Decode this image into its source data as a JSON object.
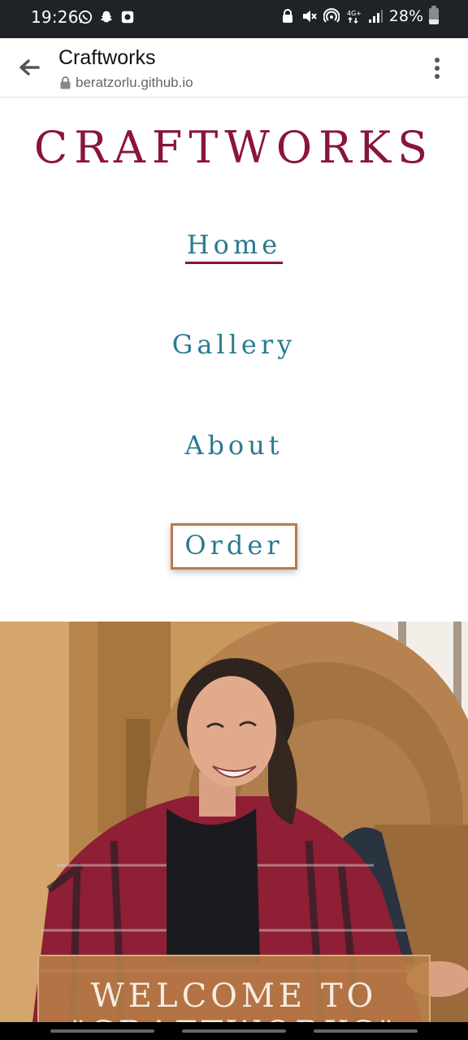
{
  "status_bar": {
    "time": "19:26",
    "battery_percent": "28%",
    "left_icons": [
      "whatsapp-icon",
      "snapchat-icon",
      "notification-icon"
    ],
    "right_icons": [
      "lock-icon",
      "mute-icon",
      "hotspot-icon",
      "4g-icon",
      "signal-icon"
    ]
  },
  "browser": {
    "title": "Craftworks",
    "url": "beratzorlu.github.io"
  },
  "page": {
    "brand": "CRAFTWORKS",
    "nav": {
      "home": "Home",
      "gallery": "Gallery",
      "about": "About",
      "order": "Order"
    },
    "hero": {
      "welcome_line1": "WELCOME TO",
      "welcome_line2": "\"CRAFTWORKS\""
    }
  },
  "colors": {
    "brand": "#8a1538",
    "nav_link": "#2a7a91",
    "order_border": "#b87a4a",
    "hero_overlay": "#b88048"
  }
}
